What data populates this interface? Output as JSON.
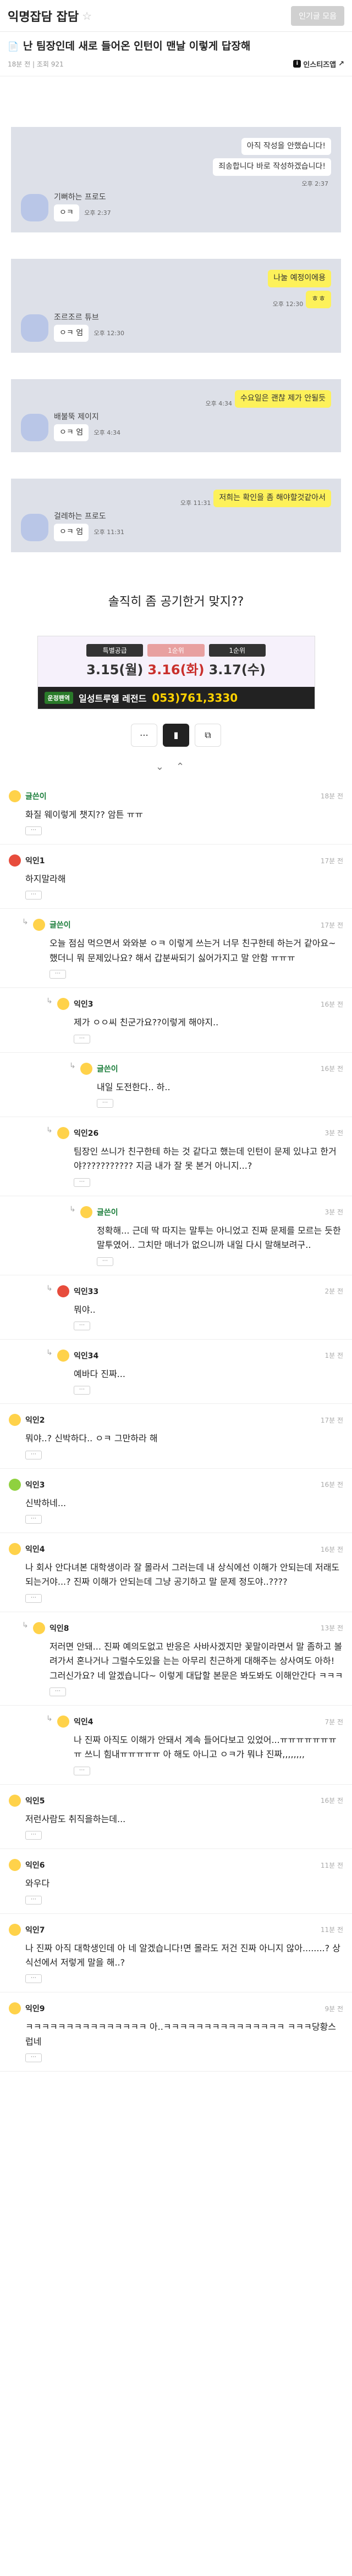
{
  "header": {
    "board": "익명잡담 잡담",
    "popular_label": "인기글 모음"
  },
  "post": {
    "title": "난 팀장인데 새로 들어온 인턴이 맨날 이렇게 답장해",
    "age": "18분 전",
    "views": "조회 921",
    "source": "인스티즈앱"
  },
  "chat": {
    "block1": {
      "mine": [
        {
          "text": "아직 작성을 안했습니다!",
          "time": ""
        },
        {
          "text": "죄송합니다 바로 작성하겠습니다!",
          "time": "오후 2:37"
        }
      ],
      "friend_name": "기뻐하는 프로도",
      "friend_msg": "ㅇㅋ",
      "friend_time": "오후 2:37"
    },
    "block2": {
      "mine": [
        {
          "text": "나눌 예정이에용",
          "time": ""
        },
        {
          "text": "ㅎㅎ",
          "time": "오후 12:30"
        }
      ],
      "friend_name": "조르조르 튜브",
      "friend_msg": "ㅇㅋ 엄",
      "friend_time": "오후 12:30"
    },
    "block3": {
      "mine": [
        {
          "text": "수요일은 괜찮 제가 안될듯",
          "time": "오후 4:34"
        }
      ],
      "friend_name": "배불뚝 제이지",
      "friend_msg": "ㅇㅋ 엄",
      "friend_time": "오후 4:34"
    },
    "block4": {
      "mine": [
        {
          "text": "저희는 확인을 좀 해야할것같아서",
          "time": "오후 11:31"
        }
      ],
      "friend_name": "걸레하는 프로도",
      "friend_msg": "ㅇㅋ 엄",
      "friend_time": "오후 11:31"
    }
  },
  "caption": "솔직히 좀 공기한거 맞지??",
  "ad": {
    "col1_head": "특별공급",
    "col1_date": "3.15(월)",
    "col2_head": "1순위",
    "col2_date": "3.16(화)",
    "col3_head": "1순위",
    "col3_date": "3.17(수)",
    "badge": "운정팬역",
    "brand": "일성트루엘 레전드",
    "phone": "053)761,3330"
  },
  "comments": [
    {
      "name": "글쓴이",
      "author": true,
      "level": 0,
      "date": "18분 전",
      "text": "화질 웨이렇게 챗지?? 암튼 ㅠㅠ",
      "icon": "yellow"
    },
    {
      "name": "익인1",
      "author": false,
      "level": 0,
      "date": "17분 전",
      "text": "하지말라해",
      "icon": "red"
    },
    {
      "name": "글쓴이",
      "author": true,
      "level": 1,
      "date": "17분 전",
      "text": "오늘 점심 먹으면서 와와분 ㅇㅋ 이렇게 쓰는거 너무 친구한테 하는거 같아요~ 했더니 뭐 문제있나요? 해서 갑분싸되기 싫어가지고 말 안함 ㅠㅠㅠ",
      "icon": "yellow"
    },
    {
      "name": "익인3",
      "author": false,
      "level": 2,
      "date": "16분 전",
      "text": "제가 ㅇㅇ씨 친군가요??이렇게 해야지..",
      "icon": "yellow"
    },
    {
      "name": "글쓴이",
      "author": true,
      "level": 3,
      "date": "16분 전",
      "text": "내일 도전한다.. 하..",
      "icon": "yellow"
    },
    {
      "name": "익인26",
      "author": false,
      "level": 2,
      "date": "3분 전",
      "text": "팀장인 쓰니가 친구한테 하는 것 같다고 했는데 인턴이 문제 있냐고 한거야??????????? 지금 내가 잘 못 본거 아니지...?",
      "icon": "yellow"
    },
    {
      "name": "글쓴이",
      "author": true,
      "level": 3,
      "date": "3분 전",
      "text": "정확해... 근데 딱 따지는 말투는 아니었고 진짜 문제를 모르는 듯한 말투였어.. 그치만 매너가 없으니까 내일 다시 말해보려구..",
      "icon": "yellow"
    },
    {
      "name": "익인33",
      "author": false,
      "level": 2,
      "date": "2분 전",
      "text": "뭐야..",
      "icon": "red"
    },
    {
      "name": "익인34",
      "author": false,
      "level": 2,
      "date": "1분 전",
      "text": "예바다 진짜...",
      "icon": "yellow"
    },
    {
      "name": "익인2",
      "author": false,
      "level": 0,
      "date": "17분 전",
      "text": "뭐야..? 신박하다.. ㅇㅋ 그만하라 해",
      "icon": "yellow"
    },
    {
      "name": "익인3",
      "author": false,
      "level": 0,
      "date": "16분 전",
      "text": "신박하네...",
      "icon": "green"
    },
    {
      "name": "익인4",
      "author": false,
      "level": 0,
      "date": "16분 전",
      "text": "나 회사 안다녀본 대학생이라 잘 몰라서 그러는데 내 상식에선 이해가 안되는데 저래도 되는거야...? 진짜 이해가 안되는데 그냥 공기하고 말 문제 정도야..????",
      "icon": "yellow"
    },
    {
      "name": "익인8",
      "author": false,
      "level": 1,
      "date": "13분 전",
      "text": "저러면 안돼... 진짜 예의도없고 반응은 사바사겠지만 꽃말이라면서 말 좀하고 볼려가서 혼나거나 그럴수도있을 는는 아무리 친근하게 대해주는 상사여도 아하! 그러신가요? 네 알겠습니다~ 이렇게 대답할 본문은 봐도봐도 이해안간다 ㅋㅋㅋ",
      "icon": "yellow"
    },
    {
      "name": "익인4",
      "author": false,
      "level": 2,
      "date": "7분 전",
      "text": "나 진짜 아직도 이해가 안돼서 계속 들어다보고 있었어...ㅠㅠㅠㅠㅠㅠㅠㅠ 쓰니 힘내ㅠㅠㅠㅠㅠ 아 해도 아니고 ㅇㅋ가 뭐냐 진짜,,,,,,,,",
      "icon": "yellow"
    },
    {
      "name": "익인5",
      "author": false,
      "level": 0,
      "date": "16분 전",
      "text": "저런사람도 취직을하는데...",
      "icon": "yellow"
    },
    {
      "name": "익인6",
      "author": false,
      "level": 0,
      "date": "11분 전",
      "text": "와우다",
      "icon": "yellow"
    },
    {
      "name": "익인7",
      "author": false,
      "level": 0,
      "date": "11분 전",
      "text": "나 진짜 아직 대학생인데 아 네 알겠습니다!면 몰라도 저건 진짜 아니지 않아........? 상식선에서 저렇게 말을 해..?",
      "icon": "yellow"
    },
    {
      "name": "익인9",
      "author": false,
      "level": 0,
      "date": "9분 전",
      "text": "ㅋㅋㅋㅋㅋㅋㅋㅋㅋㅋㅋㅋㅋㅋㅋ 아..ㅋㅋㅋㅋㅋㅋㅋㅋㅋㅋㅋㅋㅋㅋㅋ\nㅋㅋㅋ당황스럽네",
      "icon": "yellow"
    }
  ]
}
